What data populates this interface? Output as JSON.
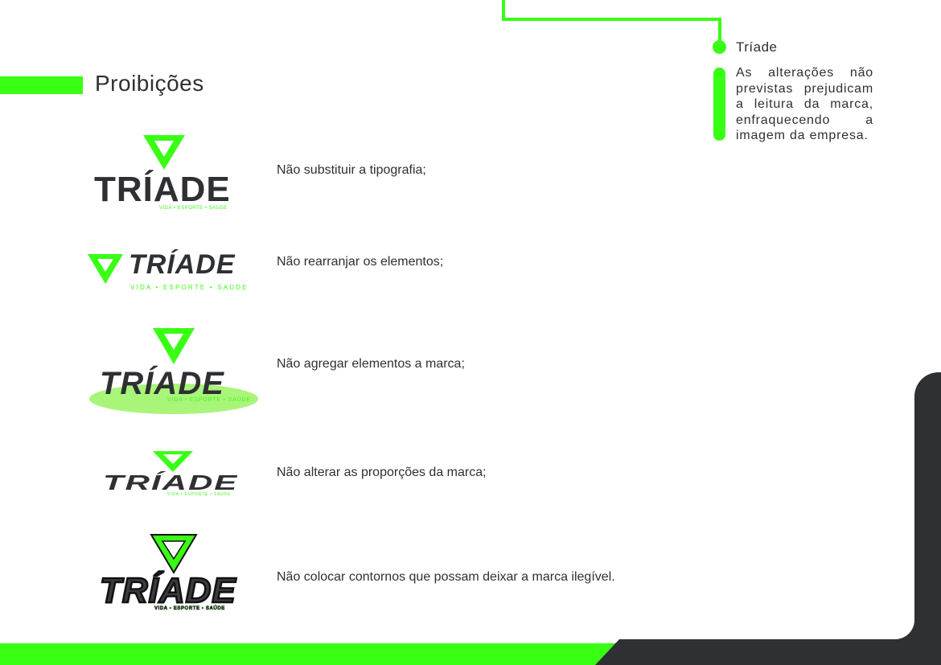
{
  "colors": {
    "accent": "#39ff14",
    "dark": "#2e3033",
    "light_green": "#a9f57a"
  },
  "page": {
    "title": "Proibições"
  },
  "sidebar": {
    "title": "Tríade",
    "body": "As alterações não previstas prejudicam a leitura da marca, enfraquecendo a imagem da empresa."
  },
  "logo": {
    "wordmark": "TRÍADE",
    "tagline": "VIDA • ESPORTE • SAÚDE"
  },
  "rules": [
    {
      "text": "Não substituir a tipografia;"
    },
    {
      "text": "Não rearranjar os elementos;"
    },
    {
      "text": "Não agregar elementos a marca;"
    },
    {
      "text": "Não alterar as proporções da marca;"
    },
    {
      "text": "Não colocar contornos que possam deixar a marca ilegível."
    }
  ]
}
